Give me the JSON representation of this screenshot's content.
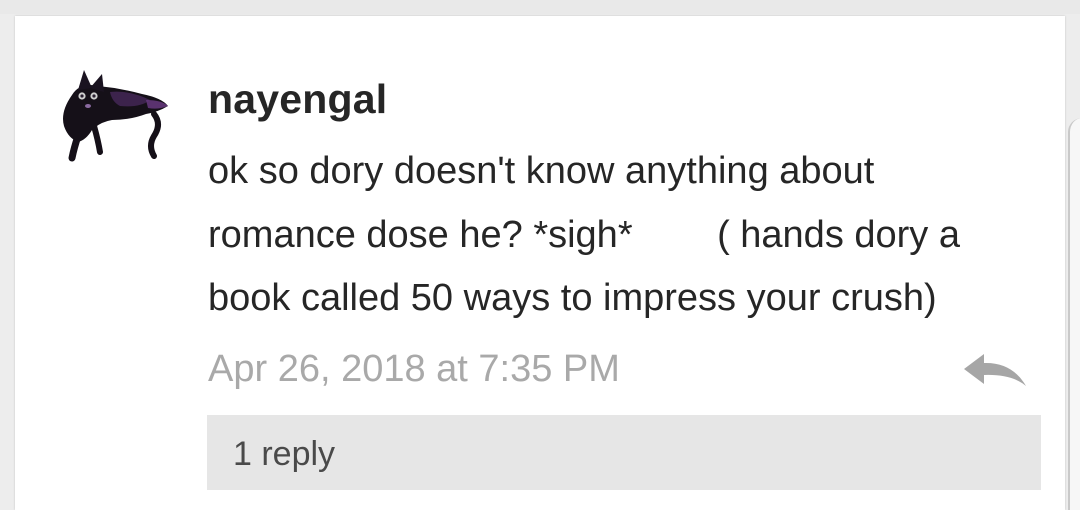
{
  "comment": {
    "username": "nayengal",
    "avatar_icon": "black-cat-avatar-icon",
    "body_lines": [
      "ok so dory doesn't know anything about",
      "romance dose he? *sigh*        ( hands dory a",
      "book called 50 ways to impress your crush)"
    ],
    "timestamp": "Apr 26, 2018 at 7:35 PM",
    "reply_icon": "reply-arrow-icon",
    "replies_label": "1 reply"
  },
  "colors": {
    "text": "#262626",
    "timestamp": "#a9a9a9",
    "replies_bg": "#e6e6e6",
    "icon": "#a6a6a6",
    "page_bg": "#ededed",
    "card_bg": "#ffffff"
  }
}
